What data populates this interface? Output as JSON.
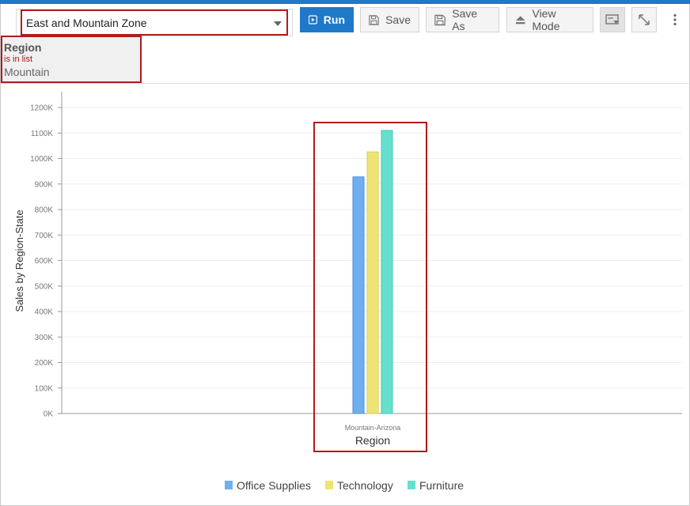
{
  "toolbar": {
    "dashboard_select_value": "East and Mountain Zone",
    "run_label": "Run",
    "save_label": "Save",
    "save_as_label": "Save As",
    "view_mode_label": "View Mode"
  },
  "filter": {
    "field": "Region",
    "operator": "is in list",
    "value": "Mountain"
  },
  "colors": {
    "accent": "#1f78c8",
    "highlight": "#b01c1c"
  },
  "chart_data": {
    "type": "bar",
    "categories": [
      "Mountain-Arizona"
    ],
    "series": [
      {
        "name": "Office Supplies",
        "values": [
          928000
        ],
        "color": "#6faff0"
      },
      {
        "name": "Technology",
        "values": [
          1026000
        ],
        "color": "#eee474"
      },
      {
        "name": "Furniture",
        "values": [
          1110000
        ],
        "color": "#66e0cc"
      }
    ],
    "ylim": [
      0,
      1200000
    ],
    "yticks": [
      "0K",
      "100K",
      "200K",
      "300K",
      "400K",
      "500K",
      "600K",
      "700K",
      "800K",
      "900K",
      "1000K",
      "1100K",
      "1200K"
    ],
    "ytick_step": 100000,
    "ylabel": "Sales by Region-State",
    "xlabel": "Region",
    "grid": true,
    "legend": "bottom-center"
  }
}
